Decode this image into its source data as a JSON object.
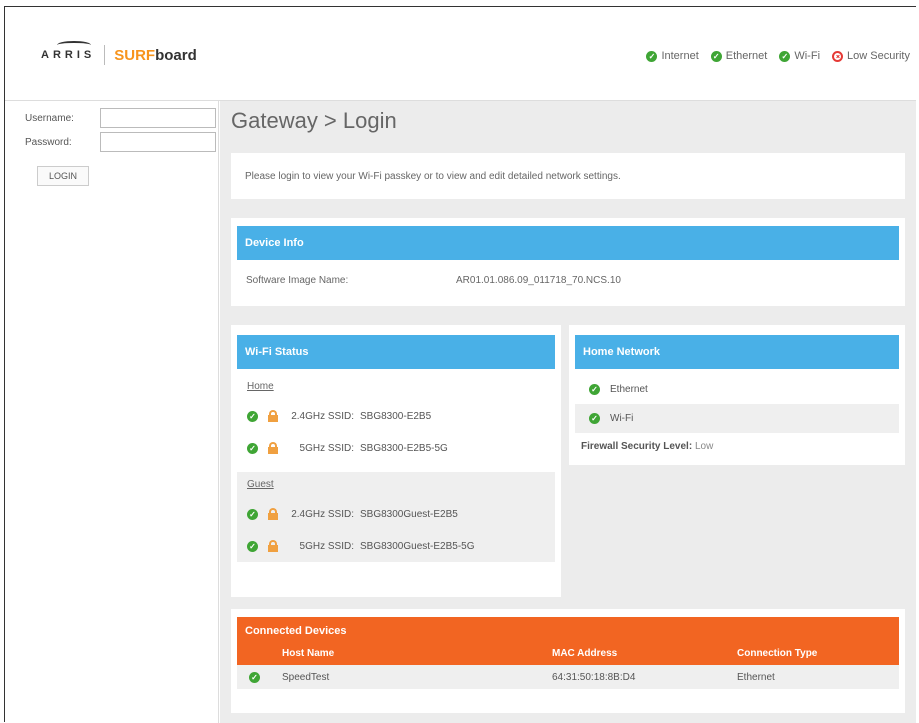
{
  "header": {
    "brand_arris": "ARRIS",
    "brand_surf": "SURF",
    "brand_board": "board",
    "status": [
      {
        "label": "Internet",
        "state": "ok"
      },
      {
        "label": "Ethernet",
        "state": "ok"
      },
      {
        "label": "Wi-Fi",
        "state": "ok"
      },
      {
        "label": "Low Security",
        "state": "warning"
      }
    ]
  },
  "login": {
    "username_label": "Username:",
    "password_label": "Password:",
    "username_value": "",
    "password_value": "",
    "button_label": "LOGIN"
  },
  "main": {
    "title": "Gateway > Login",
    "notice": "Please login to view your Wi-Fi passkey or to view and edit detailed network settings.",
    "device_info": {
      "heading": "Device Info",
      "label": "Software Image Name:",
      "value": "AR01.01.086.09_011718_70.NCS.10"
    },
    "wifi_status": {
      "heading": "Wi-Fi Status",
      "home_label": "Home",
      "guest_label": "Guest",
      "home": [
        {
          "band": "2.4GHz SSID:",
          "ssid": "SBG8300-E2B5"
        },
        {
          "band": "5GHz SSID:",
          "ssid": "SBG8300-E2B5-5G"
        }
      ],
      "guest": [
        {
          "band": "2.4GHz SSID:",
          "ssid": "SBG8300Guest-E2B5"
        },
        {
          "band": "5GHz SSID:",
          "ssid": "SBG8300Guest-E2B5-5G"
        }
      ]
    },
    "home_network": {
      "heading": "Home Network",
      "items": [
        "Ethernet",
        "Wi-Fi"
      ],
      "firewall_label": "Firewall Security Level:",
      "firewall_value": "Low"
    },
    "connected_devices": {
      "heading": "Connected Devices",
      "columns": [
        "Host Name",
        "MAC Address",
        "Connection Type"
      ],
      "rows": [
        {
          "host": "SpeedTest",
          "mac": "64:31:50:18:8B:D4",
          "type": "Ethernet"
        }
      ]
    }
  },
  "colors": {
    "accent_blue": "#49b0e7",
    "accent_orange": "#f26522",
    "ok_green": "#3fa535",
    "alert_red": "#e53935",
    "lock_orange": "#f0a040"
  }
}
